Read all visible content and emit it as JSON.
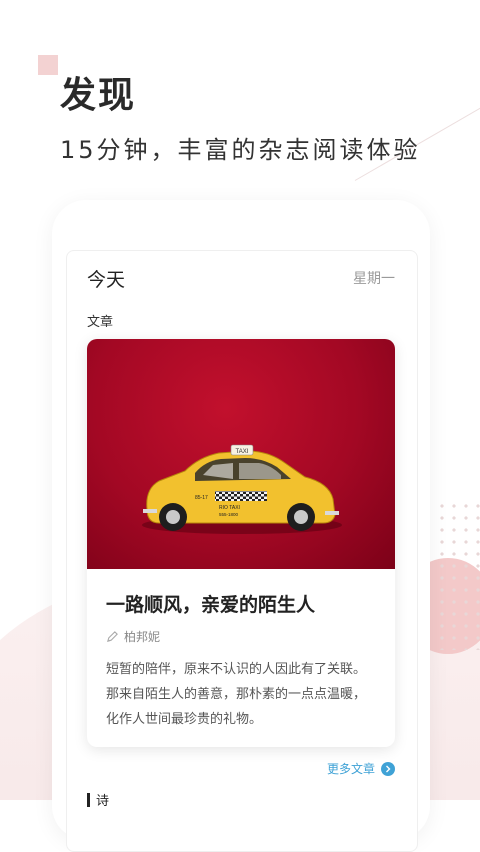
{
  "hero": {
    "title": "发现",
    "subtitle": "15分钟，丰富的杂志阅读体验"
  },
  "today": {
    "title": "今天",
    "weekday": "星期一"
  },
  "article_section": {
    "label": "文章",
    "cover_taxi_sign": "TAXI",
    "cover_car_number": "85-17",
    "cover_door_text_1": "RIO TAXI",
    "cover_door_text_2": "555-1800",
    "title": "一路顺风，亲爱的陌生人",
    "author": "柏邦妮",
    "excerpt": "短暂的陪伴，原来不认识的人因此有了关联。那来自陌生人的善意，那朴素的一点点温暖，化作人世间最珍贵的礼物。",
    "more_link": "更多文章"
  },
  "poem_section": {
    "label": "诗"
  },
  "colors": {
    "accent_blue": "#3fa2d6",
    "cover_red": "#a30824",
    "taxi_yellow": "#f2c12e",
    "deco_pink": "#f3c9c9"
  }
}
